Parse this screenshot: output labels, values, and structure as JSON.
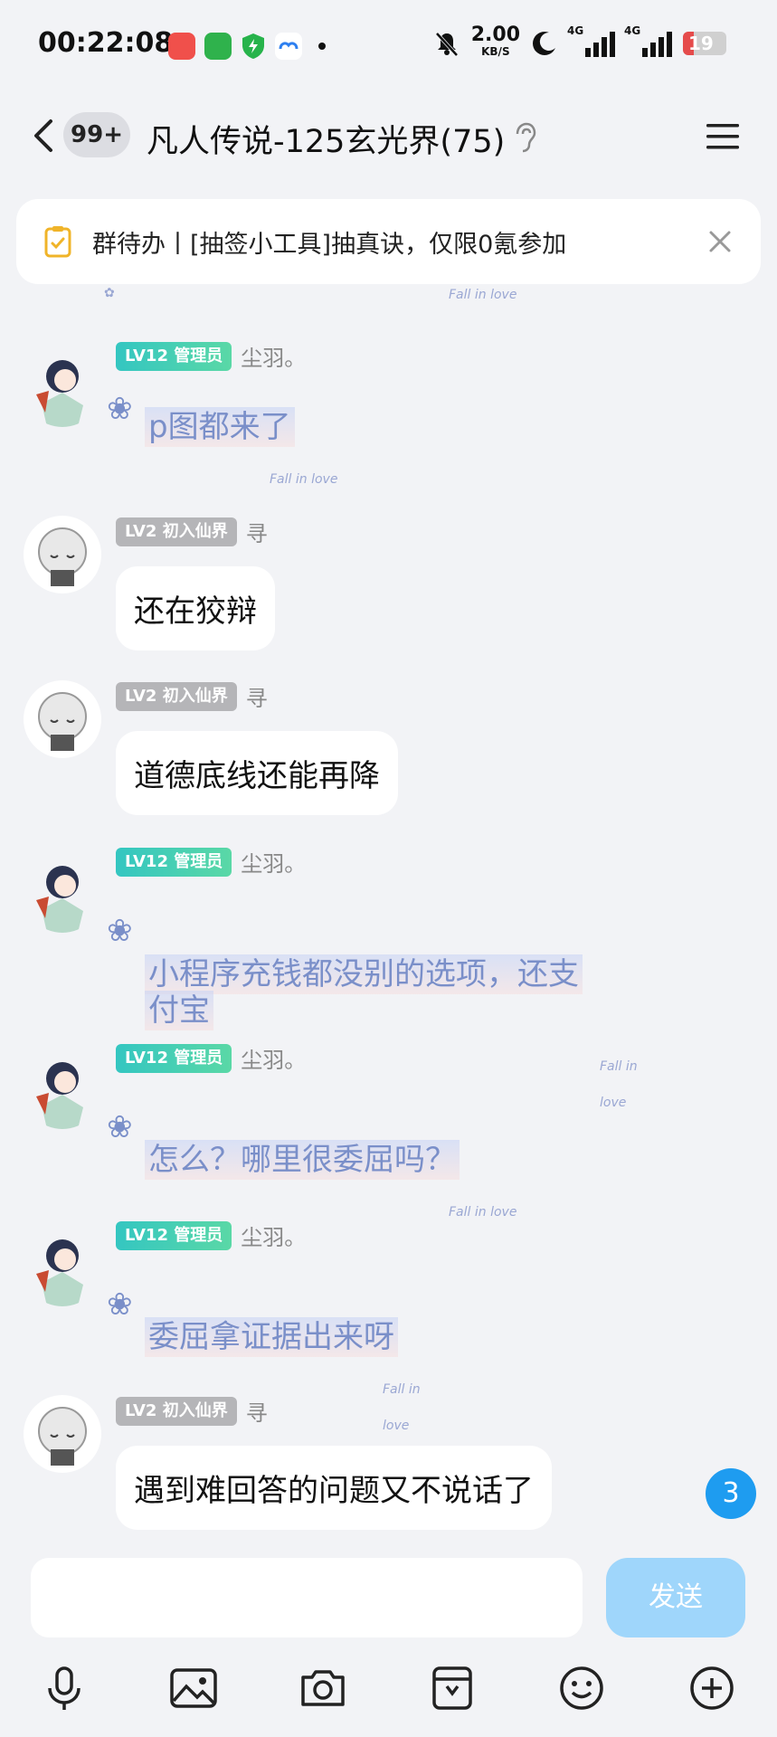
{
  "status_bar": {
    "time": "00:22:08",
    "net_speed": "2.00",
    "net_unit": "KB/S",
    "signal1_label": "4G",
    "signal2_label": "4G",
    "battery": "19"
  },
  "header": {
    "unread_count": "99+",
    "title": "凡人传说-125玄光界(75)"
  },
  "notice": {
    "text": "群待办丨[抽签小工具]抽真诀，仅限0氪参加"
  },
  "messages": [
    {
      "level": "LV12 管理员",
      "nick": "尘羽。",
      "text": "p图都来了"
    },
    {
      "level": "LV2 初入仙界",
      "nick": "寻",
      "text": "还在狡辩"
    },
    {
      "level": "LV2 初入仙界",
      "nick": "寻",
      "text": "道德底线还能再降"
    },
    {
      "level": "LV12 管理员",
      "nick": "尘羽。",
      "text_line1": "小程序充钱都没别的选项，还支",
      "text_line2": "付宝"
    },
    {
      "level": "LV12 管理员",
      "nick": "尘羽。",
      "text": "怎么？哪里很委屈吗？"
    },
    {
      "level": "LV12 管理员",
      "nick": "尘羽。",
      "text": "委屈拿证据出来呀"
    },
    {
      "level": "LV2 初入仙界",
      "nick": "寻",
      "text": "遇到难回答的问题又不说话了"
    }
  ],
  "decor_text": "Fall in love",
  "new_message_badge": "3",
  "input": {
    "value": "",
    "send_label": "发送"
  },
  "toolbar_icons": [
    "mic-icon",
    "image-icon",
    "camera-icon",
    "sticker-icon",
    "emoji-icon",
    "plus-icon"
  ]
}
